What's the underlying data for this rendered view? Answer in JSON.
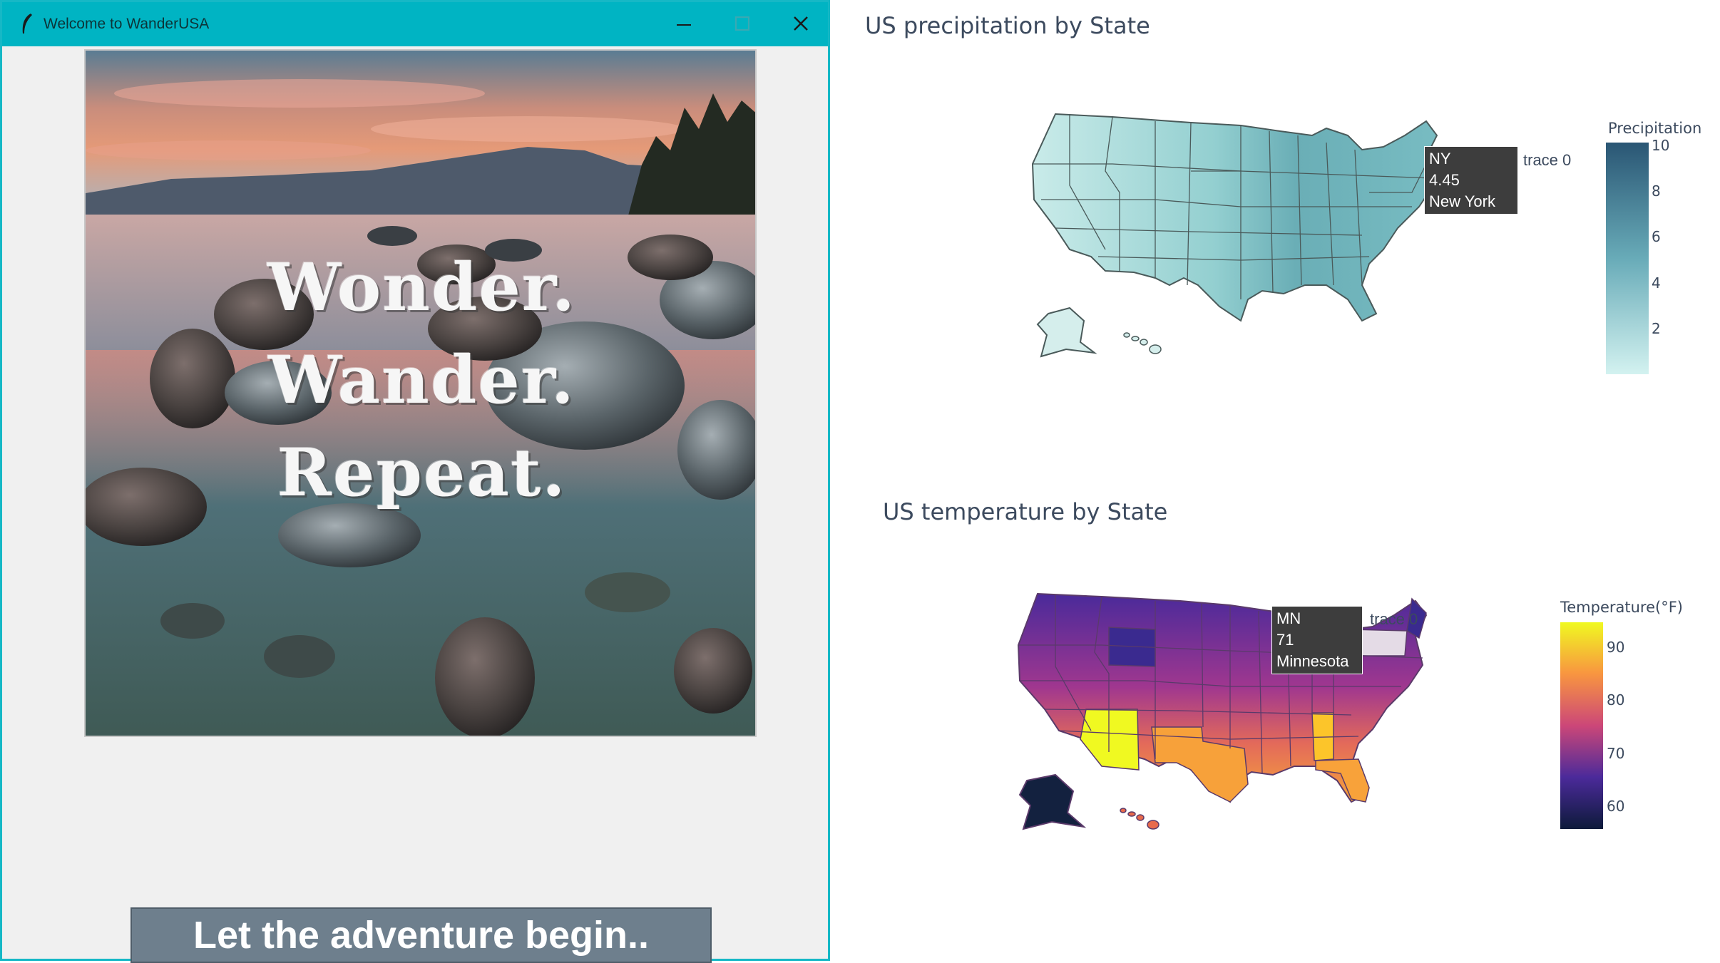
{
  "window": {
    "title": "Welcome to WanderUSA",
    "controls": {
      "minimize_icon": "minimize-icon",
      "maximize_icon": "maximize-icon",
      "close_icon": "close-icon"
    }
  },
  "hero": {
    "lines": [
      "Wonder.",
      "Wander.",
      "Repeat."
    ]
  },
  "cta_button": {
    "label": "Let the adventure begin.."
  },
  "precipitation_chart": {
    "title": "US precipitation by State",
    "colorbar_title": "Precipitation",
    "colorbar_ticks": [
      "10",
      "8",
      "6",
      "4",
      "2"
    ],
    "hover": {
      "line1": "NY",
      "line2": "4.45",
      "line3": "New York"
    },
    "trace_label": "trace 0",
    "colors": {
      "low": "#d3f0ee",
      "high": "#2a5674"
    }
  },
  "temperature_chart": {
    "title": "US temperature by State",
    "colorbar_title": "Temperature(°F)",
    "colorbar_ticks": [
      "90",
      "80",
      "70",
      "60"
    ],
    "hover": {
      "line1": "MN",
      "line2": "71",
      "line3": "Minnesota"
    },
    "trace_label": "trace 0",
    "colors": {
      "low": "#0d0887",
      "high": "#f0f921"
    }
  }
}
